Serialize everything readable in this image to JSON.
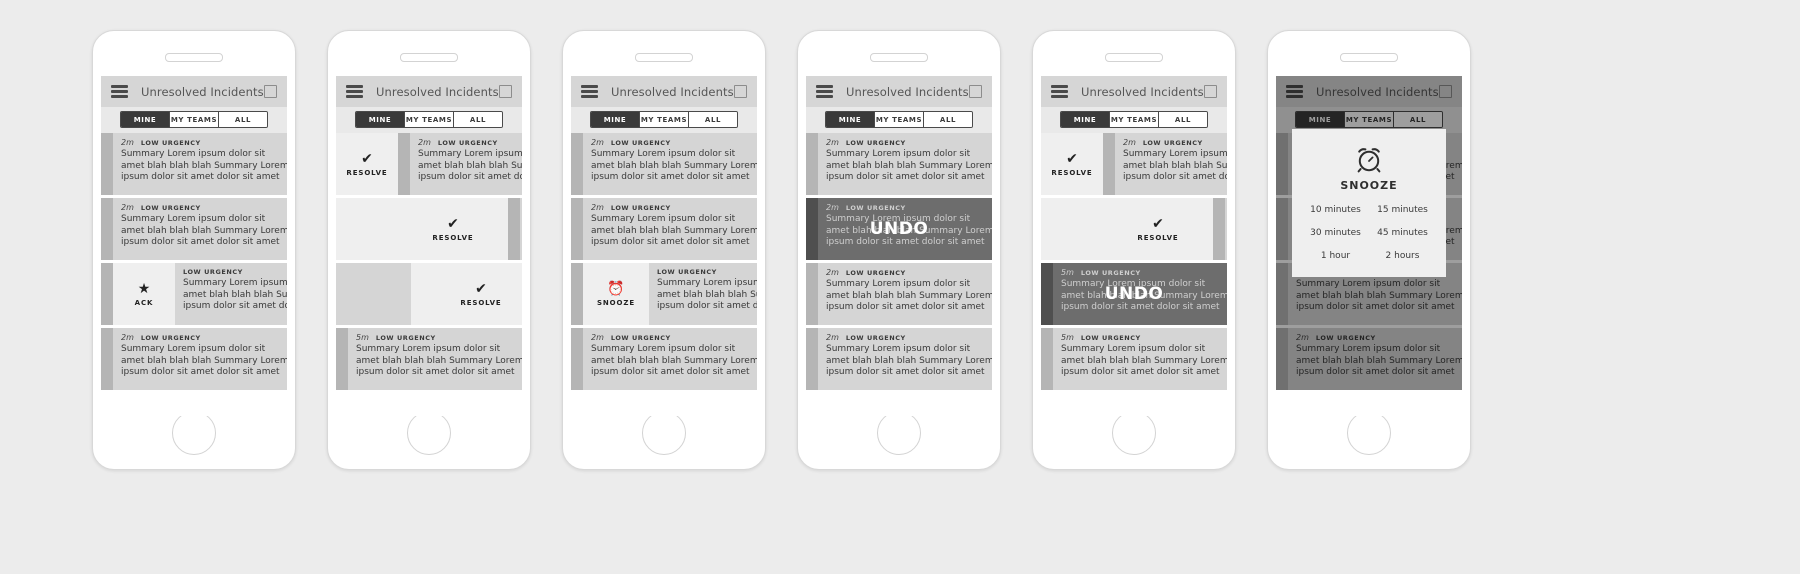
{
  "app": {
    "title": "Unresolved Incidents",
    "menu_icon": "hamburger-icon",
    "right_icon": "checkbox-square-icon",
    "segments": [
      {
        "label": "MINE",
        "selected": true
      },
      {
        "label": "MY TEAMS",
        "selected": false
      },
      {
        "label": "ALL",
        "selected": false
      }
    ]
  },
  "actions": {
    "ack": {
      "label": "ACK",
      "glyph": "★",
      "icon": "star-icon"
    },
    "resolve": {
      "label": "RESOLVE",
      "glyph": "✔",
      "icon": "checkmark-icon"
    },
    "snooze": {
      "label": "SNOOZE",
      "glyph": "⏰",
      "icon": "alarm-clock-icon"
    },
    "undo": {
      "label": "UNDO"
    }
  },
  "incident": {
    "age_2m": "2m",
    "age_5m": "5m",
    "urgency": "LOW URGENCY",
    "line1": "Summary Lorem ipsum dolor sit",
    "line2": "amet blah blah blah Summary Lorem",
    "line3": "ipsum dolor sit amet dolor sit amet"
  },
  "snooze_modal": {
    "title": "SNOOZE",
    "icon": "alarm-clock-icon",
    "options": [
      "10 minutes",
      "15 minutes",
      "30 minutes",
      "45 minutes",
      "1 hour",
      "2 hours"
    ]
  },
  "colors": {
    "page_bg": "#ececec",
    "appbar": "#d6d6d6",
    "card": "#d5d5d5",
    "gutter": "#b5b5b5",
    "action_bg": "#efefef",
    "undo_card": "#6d6d6d",
    "segment_active": "#3a3a3a"
  },
  "phones": [
    {
      "name": "phone-ack-states"
    },
    {
      "name": "phone-resolve-states"
    },
    {
      "name": "phone-snooze-states"
    },
    {
      "name": "phone-undo-snooze"
    },
    {
      "name": "phone-undo-resolve"
    },
    {
      "name": "phone-snooze-modal"
    }
  ]
}
